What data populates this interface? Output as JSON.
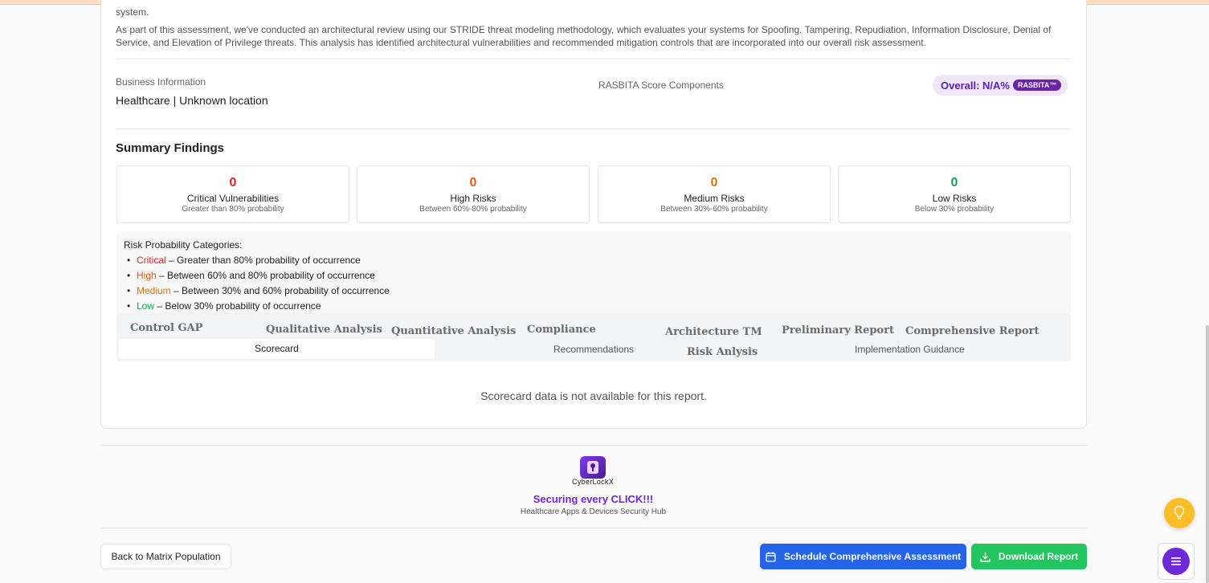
{
  "intro": {
    "line0": "system.",
    "para1": "As part of this assessment, we've conducted an architectural review using our STRIDE threat modeling methodology, which evaluates your systems for Spoofing, Tampering, Repudiation, Information Disclosure, Denial of Service, and Elevation of Privilege threats. This analysis has identified architectural vulnerabilities and recommended mitigation controls that are incorporated into our overall risk assessment."
  },
  "business": {
    "label": "Business Information",
    "value": "Healthcare | Unknown location",
    "score_label": "RASBITA Score Components",
    "overall": "Overall: N/A%",
    "badge": "RASBITA™"
  },
  "summary": {
    "title": "Summary Findings",
    "stats": [
      {
        "value": "0",
        "label": "Critical Vulnerabilities",
        "sub": "Greater than 80% probability",
        "color": "#dc2626"
      },
      {
        "value": "0",
        "label": "High Risks",
        "sub": "Between 60%-80% probability",
        "color": "#ea580c"
      },
      {
        "value": "0",
        "label": "Medium Risks",
        "sub": "Between 30%-60% probability",
        "color": "#d97706"
      },
      {
        "value": "0",
        "label": "Low Risks",
        "sub": "Below 30% probability",
        "color": "#16a34a"
      }
    ]
  },
  "categories": {
    "title": "Risk Probability Categories:",
    "items": [
      {
        "name": "Critical",
        "desc": " – Greater than 80% probability of occurrence",
        "color": "#dc2626"
      },
      {
        "name": "High",
        "desc": " – Between 60% and 80% probability of occurrence",
        "color": "#ea580c"
      },
      {
        "name": "Medium",
        "desc": " – Between 30% and 60% probability of occurrence",
        "color": "#d97706"
      },
      {
        "name": "Low",
        "desc": " – Below 30% probability of occurrence",
        "color": "#16a34a"
      }
    ]
  },
  "tabs": {
    "row1": [
      "Control GAP",
      "Qualitative Analysis",
      "Quantitative Analysis",
      "Compliance",
      "Architecture TM",
      "Preliminary Report",
      "Comprehensive Report"
    ],
    "active": "Scorecard",
    "recommendations": "Recommendations",
    "risk_analysis": "Risk Anlysis",
    "implementation": "Implementation Guidance"
  },
  "scorecard_empty": "Scorecard data is not available for this report.",
  "footer": {
    "brand": "CyberLockX",
    "slogan": "Securing every CLICK!!!",
    "slogan_sub": "Healthcare Apps & Devices Security Hub"
  },
  "buttons": {
    "back": "Back to Matrix Population",
    "schedule": "Schedule Comprehensive Assessment",
    "download": "Download Report"
  },
  "colors": {
    "accent_purple": "#6d28d9",
    "primary_blue": "#2563eb",
    "success_green": "#22c55e",
    "bulb_yellow": "#fbbf24"
  }
}
